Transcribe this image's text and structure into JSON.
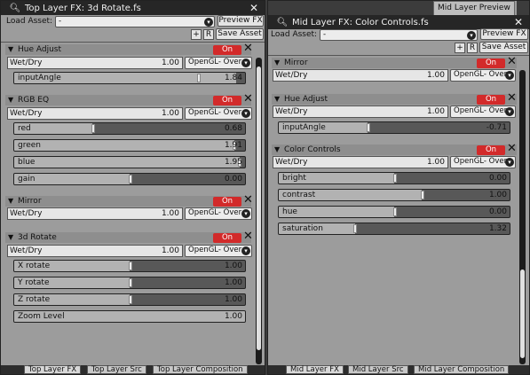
{
  "left": {
    "title": "Top Layer FX: 3d Rotate.fs",
    "close": "✕",
    "load_asset_label": "Load Asset:",
    "load_asset_value": "-",
    "preview_fx": "Preview FX",
    "plus": "+",
    "r": "R",
    "save_asset": "Save Asset",
    "sections": [
      {
        "name": "Hue Adjust",
        "on": "On",
        "wetdry": "Wet/Dry",
        "wetdry_value": "1.00",
        "blend": "OpenGL- Over",
        "params": [
          {
            "label": "inputAngle",
            "value": "1.84",
            "level": 0.96
          }
        ]
      },
      {
        "name": "RGB EQ",
        "on": "On",
        "wetdry": "Wet/Dry",
        "wetdry_value": "1.00",
        "blend": "OpenGL- Over",
        "params": [
          {
            "label": "red",
            "value": "0.68",
            "level": 0.34
          },
          {
            "label": "green",
            "value": "1.91",
            "level": 0.955
          },
          {
            "label": "blue",
            "value": "1.95",
            "level": 0.975
          },
          {
            "label": "gain",
            "value": "0.00",
            "level": 0.5
          }
        ]
      },
      {
        "name": "Mirror",
        "on": "On",
        "wetdry": "Wet/Dry",
        "wetdry_value": "1.00",
        "blend": "OpenGL- Over",
        "params": []
      },
      {
        "name": "3d Rotate",
        "on": "On",
        "wetdry": "Wet/Dry",
        "wetdry_value": "1.00",
        "blend": "OpenGL- Over",
        "params": [
          {
            "label": "X rotate",
            "value": "1.00",
            "level": 0.5
          },
          {
            "label": "Y rotate",
            "value": "1.00",
            "level": 0.5
          },
          {
            "label": "Z rotate",
            "value": "1.00",
            "level": 0.5
          },
          {
            "label": "Zoom Level",
            "value": "1.00",
            "level": 1.0
          }
        ]
      }
    ],
    "tabs": [
      "Top Layer FX",
      "Top Layer Src",
      "Top Layer Composition"
    ]
  },
  "right": {
    "top_tab": "Mid Layer Preview",
    "title": "Mid Layer FX: Color Controls.fs",
    "close": "✕",
    "load_asset_label": "Load Asset:",
    "load_asset_value": "-",
    "preview_fx": "Preview FX",
    "plus": "+",
    "r": "R",
    "save_asset": "Save Asset",
    "sections": [
      {
        "name": "Mirror",
        "on": "On",
        "wetdry": "Wet/Dry",
        "wetdry_value": "1.00",
        "blend": "OpenGL- Over",
        "params": []
      },
      {
        "name": "Hue Adjust",
        "on": "On",
        "wetdry": "Wet/Dry",
        "wetdry_value": "1.00",
        "blend": "OpenGL- Over",
        "params": [
          {
            "label": "inputAngle",
            "value": "-0.71",
            "level": 0.385
          }
        ]
      },
      {
        "name": "Color Controls",
        "on": "On",
        "wetdry": "Wet/Dry",
        "wetdry_value": "1.00",
        "blend": "OpenGL- Over",
        "params": [
          {
            "label": "bright",
            "value": "0.00",
            "level": 0.5
          },
          {
            "label": "contrast",
            "value": "1.00",
            "level": 0.62
          },
          {
            "label": "hue",
            "value": "0.00",
            "level": 0.5
          },
          {
            "label": "saturation",
            "value": "1.32",
            "level": 0.33
          }
        ]
      }
    ],
    "tabs": [
      "Mid Layer FX",
      "Mid Layer Src",
      "Mid Layer Composition"
    ]
  },
  "icons": {
    "search": "search-icon",
    "triangle": "disclosure-triangle-icon",
    "chevron": "chevron-down-icon",
    "close": "close-icon"
  },
  "colors": {
    "on": "#d22a2a",
    "titlebar": "#262626",
    "panel": "#9c9c9c"
  }
}
